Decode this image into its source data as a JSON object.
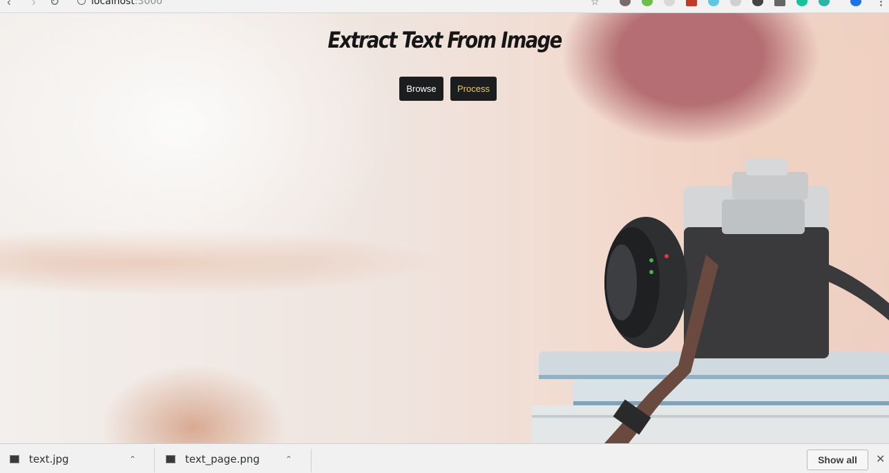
{
  "browser": {
    "url_host": "localhost",
    "url_port": ":3000",
    "back_icon": "chevron-left-icon",
    "forward_icon": "chevron-right-icon",
    "reload_icon": "reload-icon"
  },
  "page": {
    "title": "Extract Text From Image",
    "browse_label": "Browse",
    "process_label": "Process"
  },
  "downloads": {
    "items": [
      {
        "name": "text.jpg"
      },
      {
        "name": "text_page.png"
      }
    ],
    "show_all_label": "Show all"
  },
  "colors": {
    "button_bg": "#1c1d1f",
    "browse_text": "#ffffff",
    "process_text": "#e7cd65"
  }
}
